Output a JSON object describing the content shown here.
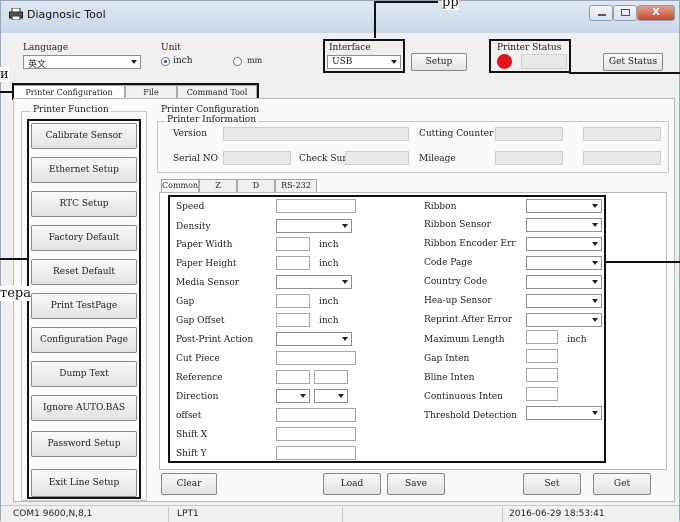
{
  "window": {
    "title": "Diagnosic Tool",
    "close": "X"
  },
  "external": {
    "top_fragment": "pp",
    "left_fragment_1": "и",
    "left_fragment_2": "тера"
  },
  "top": {
    "language_label": "Language",
    "language_value": "英文",
    "unit_label": "Unit",
    "unit_inch": "inch",
    "unit_mm": "mm",
    "interface_label": "Interface",
    "interface_value": "USB",
    "setup_button": "Setup",
    "printer_status_label": "Printer  Status",
    "get_status_button": "Get Status",
    "status_color": "#e0141b"
  },
  "tabs": [
    "Printer Configuration",
    "File Manager",
    "Command Tool"
  ],
  "functions": {
    "group_label": "Printer  Function",
    "buttons": [
      "Calibrate Sensor",
      "Ethernet Setup",
      "RTC Setup",
      "Factory Default",
      "Reset Default",
      "Print TestPage",
      "Configuration Page",
      "Dump Text",
      "Ignore AUTO.BAS",
      "Password Setup",
      "Exit Line Setup"
    ]
  },
  "config": {
    "group_label": "Printer Configuration",
    "info_label": "Printer Information",
    "version": "Version",
    "cutting_counter": "Cutting Counter",
    "serial_no": "Serial NO",
    "check_sum": "Check Sum",
    "mileage": "Mileage"
  },
  "inner_tabs": [
    "Common",
    "Z",
    "D",
    "RS-232"
  ],
  "left_fields": [
    {
      "label": "Speed",
      "unit": ""
    },
    {
      "label": "Density",
      "unit": ""
    },
    {
      "label": "Paper Width",
      "unit": "inch"
    },
    {
      "label": "Paper Height",
      "unit": "inch"
    },
    {
      "label": "Media Sensor",
      "unit": ""
    },
    {
      "label": "Gap",
      "unit": "inch"
    },
    {
      "label": "Gap Offset",
      "unit": "inch"
    },
    {
      "label": "Post-Print  Action",
      "unit": ""
    },
    {
      "label": "Cut  Piece",
      "unit": ""
    },
    {
      "label": "Reference",
      "unit": ""
    },
    {
      "label": "Direction",
      "unit": ""
    },
    {
      "label": "offset",
      "unit": ""
    },
    {
      "label": "Shift X",
      "unit": ""
    },
    {
      "label": "Shift Y",
      "unit": ""
    }
  ],
  "right_fields": [
    {
      "label": "Ribbon",
      "unit": ""
    },
    {
      "label": "Ribbon  Sensor",
      "unit": ""
    },
    {
      "label": "Ribbon Encoder Err",
      "unit": ""
    },
    {
      "label": "Code Page",
      "unit": ""
    },
    {
      "label": "Country Code",
      "unit": ""
    },
    {
      "label": "Hea-up  Sensor",
      "unit": ""
    },
    {
      "label": "Reprint After  Error",
      "unit": ""
    },
    {
      "label": "Maximum Length",
      "unit": "inch"
    },
    {
      "label": "Gap Inten",
      "unit": ""
    },
    {
      "label": "Bline  Inten",
      "unit": ""
    },
    {
      "label": "Continuous  Inten",
      "unit": ""
    },
    {
      "label": "Threshold  Detection",
      "unit": ""
    }
  ],
  "bottom_buttons": {
    "clear": "Clear",
    "load": "Load",
    "save": "Save",
    "set": "Set",
    "get": "Get"
  },
  "statusbar": [
    "COM1 9600,N,8,1",
    "LPT1",
    "",
    "2016-06-29  18:53:41"
  ]
}
